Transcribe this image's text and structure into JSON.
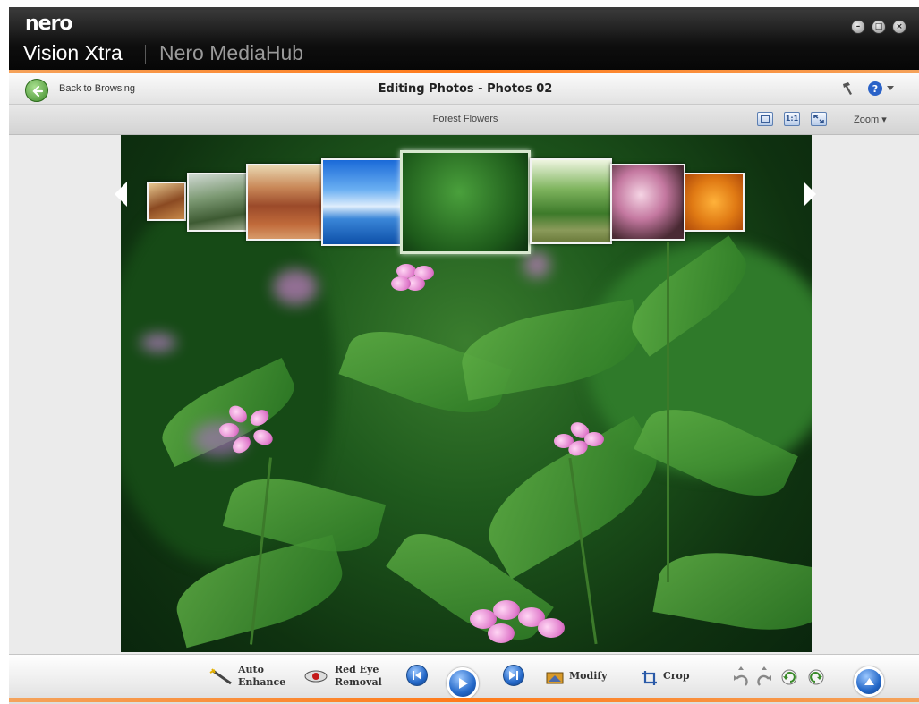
{
  "window": {
    "brand": "nero",
    "app_name": "Vision Xtra",
    "secondary_app": "Nero MediaHub",
    "controls": [
      "minimize",
      "maximize",
      "close"
    ]
  },
  "navbar": {
    "back_label": "Back to Browsing",
    "title": "Editing Photos - Photos 02",
    "tools": [
      "hammer-icon",
      "help-icon"
    ]
  },
  "subbar": {
    "album": "Forest Flowers",
    "view_buttons": [
      "fit-window",
      "actual-size",
      "fullscreen"
    ],
    "view_buttons_text": {
      "actual_size": "1:1"
    },
    "zoom_label": "Zoom"
  },
  "filmstrip": {
    "selected_index": 4,
    "thumbs": [
      "desert-arch",
      "river-valley",
      "red-buttes",
      "blue-sky-lake",
      "forest-flowers",
      "forest-path",
      "pink-blossoms",
      "orange-flowers"
    ]
  },
  "toolbar": {
    "auto_enhance_line1": "Auto",
    "auto_enhance_line2": "Enhance",
    "red_eye_line1": "Red Eye",
    "red_eye_line2": "Removal",
    "modify": "Modify",
    "crop": "Crop",
    "playback": [
      "previous",
      "play",
      "next"
    ],
    "history": [
      "undo",
      "redo",
      "rotate-left",
      "rotate-right"
    ],
    "expand": "expand"
  },
  "colors": {
    "accent_orange": "#ff7a1a",
    "titlebar": "#0e0e0e",
    "button_blue": "#2468c8",
    "back_green": "#3f8b2a"
  }
}
